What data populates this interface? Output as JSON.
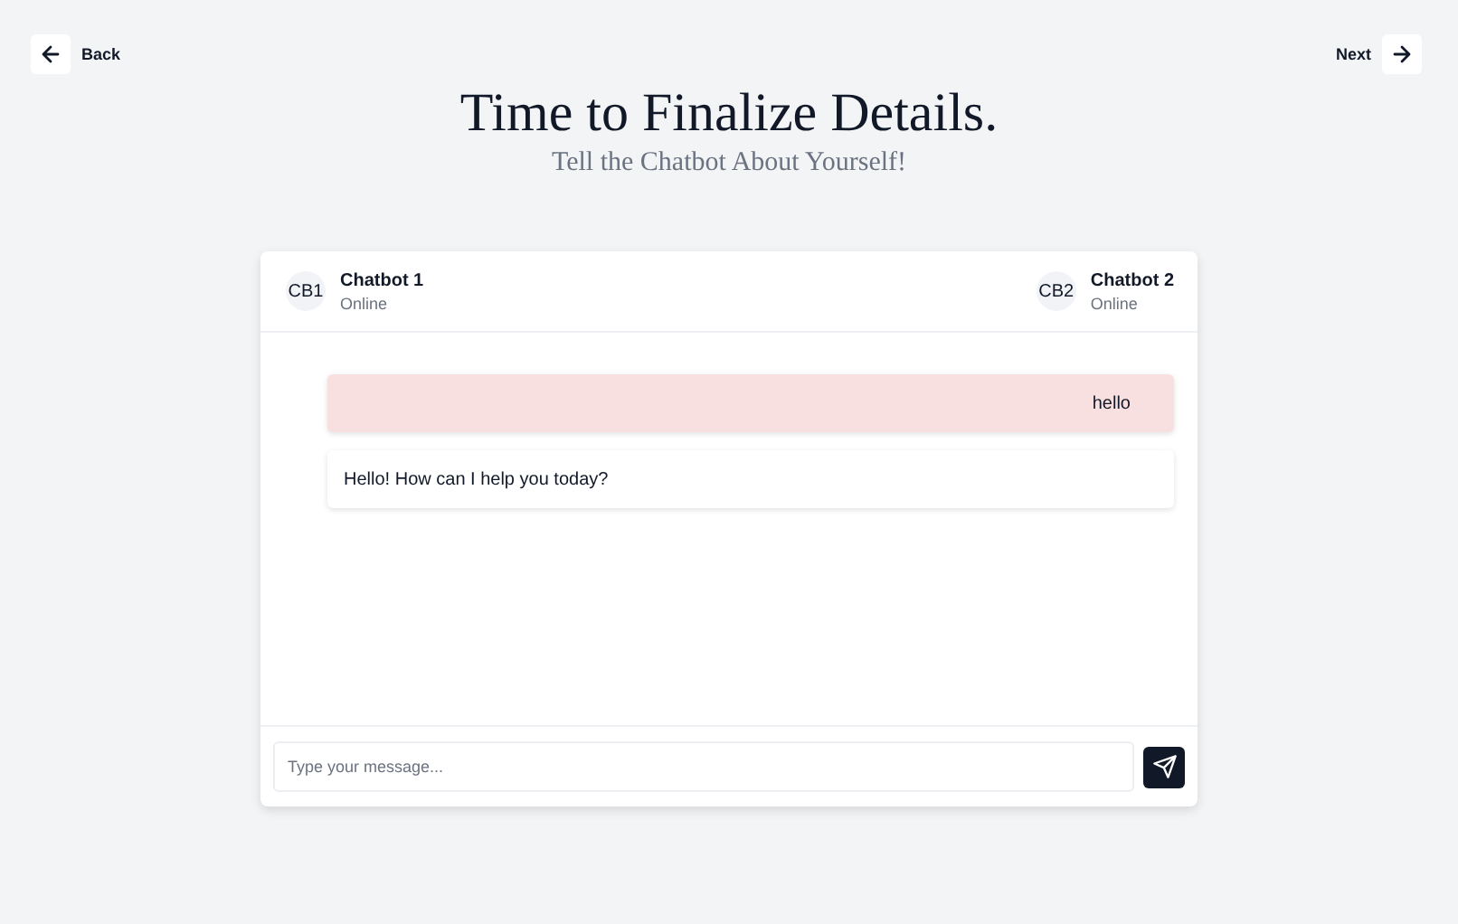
{
  "nav": {
    "back": "Back",
    "next": "Next"
  },
  "heading": {
    "title": "Time to Finalize Details.",
    "subtitle": "Tell the Chatbot About Yourself!"
  },
  "chat": {
    "participants": [
      {
        "initials": "CB1",
        "name": "Chatbot 1",
        "status": "Online"
      },
      {
        "initials": "CB2",
        "name": "Chatbot 2",
        "status": "Online"
      }
    ],
    "messages": [
      {
        "kind": "user",
        "text": "hello"
      },
      {
        "kind": "bot",
        "text": "Hello! How can I help you today?"
      }
    ],
    "input": {
      "placeholder": "Type your message..."
    }
  }
}
